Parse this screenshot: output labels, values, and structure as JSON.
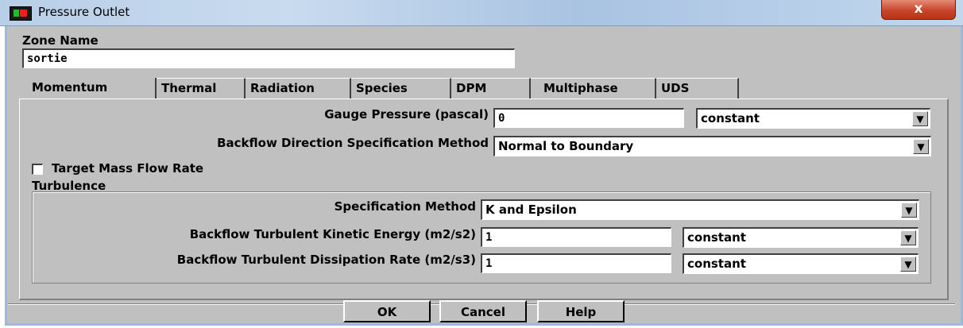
{
  "window": {
    "title": "Pressure Outlet",
    "close_glyph": "x"
  },
  "zone": {
    "label": "Zone Name",
    "value": "sortie"
  },
  "tabs": [
    "Momentum",
    "Thermal",
    "Radiation",
    "Species",
    "DPM",
    "Multiphase",
    "UDS"
  ],
  "active_tab": "Momentum",
  "momentum": {
    "gauge_pressure": {
      "label": "Gauge Pressure (pascal)",
      "value": "0",
      "method": "constant"
    },
    "backflow_direction": {
      "label": "Backflow Direction Specification Method",
      "value": "Normal to Boundary"
    },
    "target_mass_flow": {
      "label": "Target Mass Flow Rate",
      "checked": false
    }
  },
  "turbulence": {
    "label": "Turbulence",
    "specification": {
      "label": "Specification Method",
      "value": "K and Epsilon"
    },
    "kinetic_energy": {
      "label": "Backflow Turbulent Kinetic Energy (m2/s2)",
      "value": "1",
      "method": "constant"
    },
    "dissipation": {
      "label": "Backflow Turbulent Dissipation Rate (m2/s3)",
      "value": "1",
      "method": "constant"
    }
  },
  "buttons": {
    "ok": "OK",
    "cancel": "Cancel",
    "help": "Help"
  },
  "icons": {
    "dropdown": "chevron-down-icon",
    "app": "fluent-app-icon"
  }
}
